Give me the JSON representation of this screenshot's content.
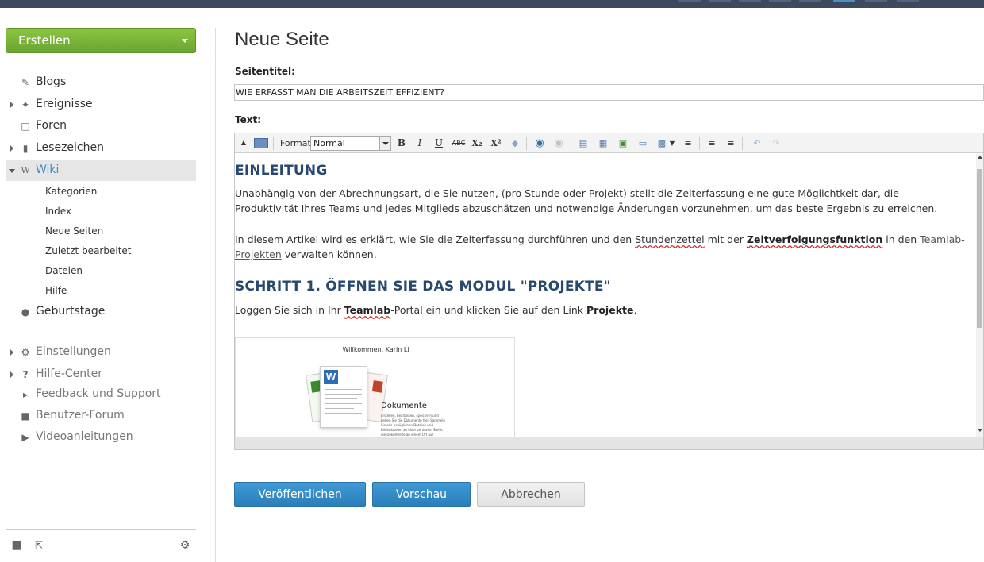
{
  "sidebar": {
    "create_label": "Erstellen",
    "items": [
      {
        "label": "Blogs",
        "icon": "edit-icon"
      },
      {
        "label": "Ereignisse",
        "icon": "pin-icon"
      },
      {
        "label": "Foren",
        "icon": "speech-bubble-icon"
      },
      {
        "label": "Lesezeichen",
        "icon": "bookmark-icon"
      },
      {
        "label": "Wiki",
        "icon": "wiki-icon"
      },
      {
        "label": "Geburtstage",
        "icon": "people-icon"
      },
      {
        "label": "Einstellungen",
        "icon": "gear-icon"
      },
      {
        "label": "Hilfe-Center",
        "icon": "question-icon"
      },
      {
        "label": "Feedback und Support",
        "icon": "megaphone-icon"
      },
      {
        "label": "Benutzer-Forum",
        "icon": "chat-icon"
      },
      {
        "label": "Videoanleitungen",
        "icon": "play-icon"
      }
    ],
    "wiki_sub": [
      "Kategorien",
      "Index",
      "Neue Seiten",
      "Zuletzt bearbeitet",
      "Dateien",
      "Hilfe"
    ]
  },
  "page": {
    "title": "Neue Seite",
    "page_title_label": "Seitentitel:",
    "page_title_value": "WIE ERFASST MAN DIE ARBEITSZEIT EFFIZIENT?",
    "text_label": "Text:"
  },
  "toolbar": {
    "format_label": "Format",
    "format_value": "Normal",
    "bold": "B",
    "italic": "I",
    "underline": "U",
    "strike": "ABC",
    "subscript": "X₂",
    "superscript": "X²"
  },
  "content": {
    "h1": "EINLEITUNG",
    "p1": "Unabhängig von der Abrechnungsart, die Sie nutzen, (pro Stunde oder Projekt) stellt die Zeiterfassung eine gute Möglichtkeit dar, die Produktivität Ihres Teams und jedes Mitglieds abzuschätzen und notwendige Änderungen vorzunehmen, um das beste Ergebnis zu erreichen.",
    "p2_a": "In diesem Artikel wird es erklärt, wie Sie die Zeiterfassung durchführen und den ",
    "p2_b": "Stundenzettel",
    "p2_c": " mit der ",
    "p2_d": "Zeitverfolgungsfunktion",
    "p2_e": " in den ",
    "p2_f": "Teamlab-Projekten",
    "p2_g": " verwalten können.",
    "h2": "SCHRITT 1. ÖFFNEN SIE DAS MODUL \"PROJEKTE\"",
    "p3_a": "Loggen Sie sich in Ihr ",
    "p3_b": "Teamlab",
    "p3_c": "-Portal ein und klicken Sie auf den Link ",
    "p3_d": "Projekte",
    "p3_e": ".",
    "img_welcome": "Willkommen, Karin Li",
    "img_title": "Dokumente",
    "img_text": "Erstellen, bearbeiten, speichern und geben Sie die Dokumente frei. Sammeln Sie alle bezüglichen Dateien und Bilderdateien an einer zentralen Stelle, die Dokumente an einem Ort auf"
  },
  "buttons": {
    "publish": "Veröffentlichen",
    "preview": "Vorschau",
    "cancel": "Abbrechen"
  }
}
